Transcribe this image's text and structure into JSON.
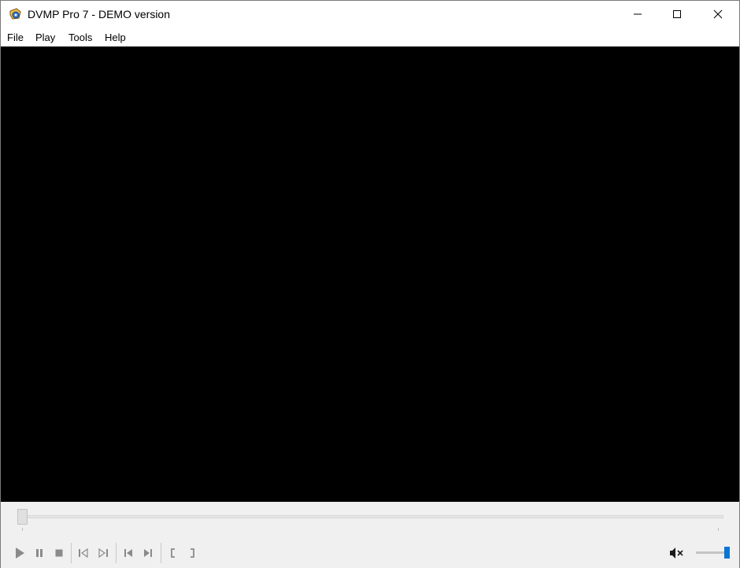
{
  "window": {
    "title": "DVMP Pro 7 - DEMO version",
    "app_icon": "dvmp-app-icon",
    "controls": [
      "minimize-icon",
      "maximize-icon",
      "close-icon"
    ]
  },
  "menu": {
    "items": [
      {
        "label": "File"
      },
      {
        "label": "Play"
      },
      {
        "label": "Tools"
      },
      {
        "label": "Help"
      }
    ]
  },
  "player": {
    "video_background": "#000000",
    "seek_position": 0,
    "volume_level": 1.0,
    "muted": true,
    "accent_color": "#0a75d6",
    "buttons": [
      "play-icon",
      "pause-icon",
      "stop-icon",
      "frame-back-icon",
      "frame-forward-icon",
      "previous-icon",
      "next-icon",
      "mark-in-icon",
      "mark-out-icon",
      "mute-icon"
    ]
  }
}
